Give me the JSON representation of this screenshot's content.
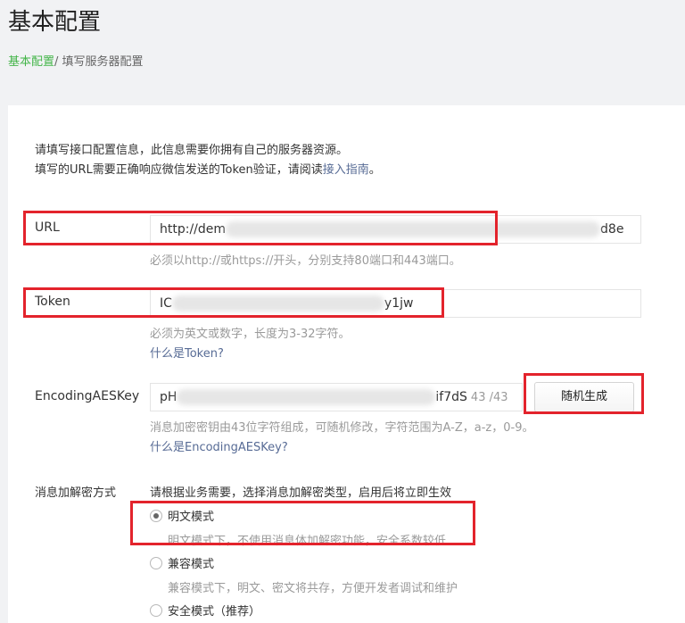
{
  "page": {
    "title": "基本配置",
    "breadcrumb": {
      "link": "基本配置",
      "separator": "/ ",
      "current": "填写服务器配置"
    }
  },
  "intro": {
    "line1": "请填写接口配置信息，此信息需要你拥有自己的服务器资源。",
    "line2_prefix": "填写的URL需要正确响应微信发送的Token验证，请阅读",
    "line2_link": "接入指南",
    "line2_suffix": "。"
  },
  "url": {
    "label": "URL",
    "value_start": "http://dem",
    "value_end": "d8e",
    "hint": "必须以http://或https://开头，分别支持80端口和443端口。"
  },
  "token": {
    "label": "Token",
    "value_start": "IC",
    "value_end": "y1jw",
    "hint": "必须为英文或数字，长度为3-32字符。",
    "help_link": "什么是Token?"
  },
  "aeskey": {
    "label": "EncodingAESKey",
    "value_start": "pH",
    "value_end": "if7dS",
    "counter": "43 /43",
    "generate_button": "随机生成",
    "hint": "消息加密密钥由43位字符组成，可随机修改，字符范围为A-Z，a-z，0-9。",
    "help_link": "什么是EncodingAESKey?"
  },
  "encryption": {
    "label": "消息加解密方式",
    "hint": "请根据业务需要，选择消息加解密类型，启用后将立即生效",
    "options": [
      {
        "label": "明文模式",
        "desc": "明文模式下，不使用消息体加解密功能，安全系数较低",
        "checked": true
      },
      {
        "label": "兼容模式",
        "desc": "兼容模式下，明文、密文将共存，方便开发者调试和维护",
        "checked": false
      },
      {
        "label": "安全模式（推荐）",
        "desc": "",
        "checked": false
      }
    ]
  },
  "colors": {
    "highlight": "#e3232c",
    "link": "#576b95",
    "brand": "#44b549"
  }
}
